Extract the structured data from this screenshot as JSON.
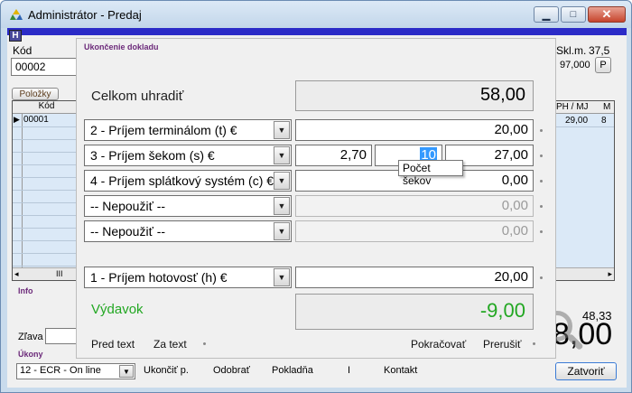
{
  "window": {
    "title": "Administrátor - Predaj",
    "badge": "H"
  },
  "header": {
    "code_label": "Kód",
    "code_value": "00002",
    "stock_label": "Skl.m.",
    "stock_value": "37,5",
    "amount_value": "97,000",
    "p_button": "P"
  },
  "items": {
    "button": "Položky",
    "col_code": "Kód",
    "rows": [
      "00001"
    ],
    "scroll_mark": "III"
  },
  "right_table": {
    "col_price": "PH / MJ",
    "col_m": "M",
    "rows": [
      {
        "price": "29,00",
        "m": "8"
      }
    ]
  },
  "info_label": "Info",
  "discount_label": "Zľava",
  "ukony": {
    "label": "Úkony",
    "select_value": "12 - ECR - On line",
    "links": [
      "Ukončiť p.",
      "Odobrať",
      "Pokladňa",
      "I",
      "Kontakt"
    ],
    "close_button": "Zatvoriť"
  },
  "totals": {
    "small": "48,33",
    "big": "8,00"
  },
  "dialog": {
    "title": "Ukončenie dokladu",
    "total_label": "Celkom uhradiť",
    "total_value": "58,00",
    "payments": [
      {
        "label": "2 - Príjem terminálom (t) €",
        "value": "20,00",
        "enabled": true
      },
      {
        "label": "3 - Príjem šekom (s) €",
        "unit": "2,70",
        "count": "10",
        "value": "27,00",
        "enabled": true
      },
      {
        "label": "4 - Príjem splátkový systém (c) €",
        "value": "0,00",
        "enabled": true
      },
      {
        "label": "-- Nepoužiť --",
        "value": "0,00",
        "enabled": false
      },
      {
        "label": "-- Nepoužiť --",
        "value": "0,00",
        "enabled": false
      }
    ],
    "tooltip": "Počet šekov",
    "cash_label": "1 - Príjem hotovosť (h) €",
    "cash_value": "20,00",
    "expense_label": "Výdavok",
    "expense_value": "-9,00",
    "pretext": "Pred text",
    "zatext": "Za text",
    "continue": "Pokračovať",
    "cancel": "Prerušiť"
  }
}
